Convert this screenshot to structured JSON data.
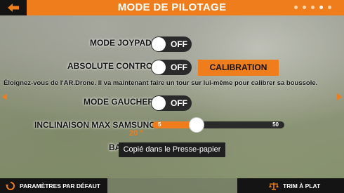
{
  "header": {
    "title": "MODE DE PILOTAGE",
    "back_icon": "back-arrow-icon",
    "page_dots": 5,
    "active_dot": 4
  },
  "settings": {
    "joypad": {
      "label": "MODE JOYPAD",
      "state": "OFF"
    },
    "absolute": {
      "label": "ABSOLUTE CONTROL",
      "state": "OFF"
    },
    "calibration_button": "CALIBRATION",
    "info": "Éloignez-vous de l'AR.Drone. Il va maintenant faire un tour sur lui-même pour calibrer sa boussole.",
    "left_handed": {
      "label": "MODE GAUCHER",
      "state": "OFF"
    },
    "tilt": {
      "label": "INCLINAISON MAX SAMSUNG",
      "min": "5",
      "max": "50",
      "value": "20 °",
      "value_num": 20
    },
    "partial_label": "BA"
  },
  "toast": "Copié dans le Presse-papier",
  "footer": {
    "defaults_label": "PARAMÈTRES PAR DÉFAUT",
    "trim_label": "TRIM À PLAT"
  },
  "colors": {
    "accent": "#f07d1b",
    "dark": "#141414"
  }
}
